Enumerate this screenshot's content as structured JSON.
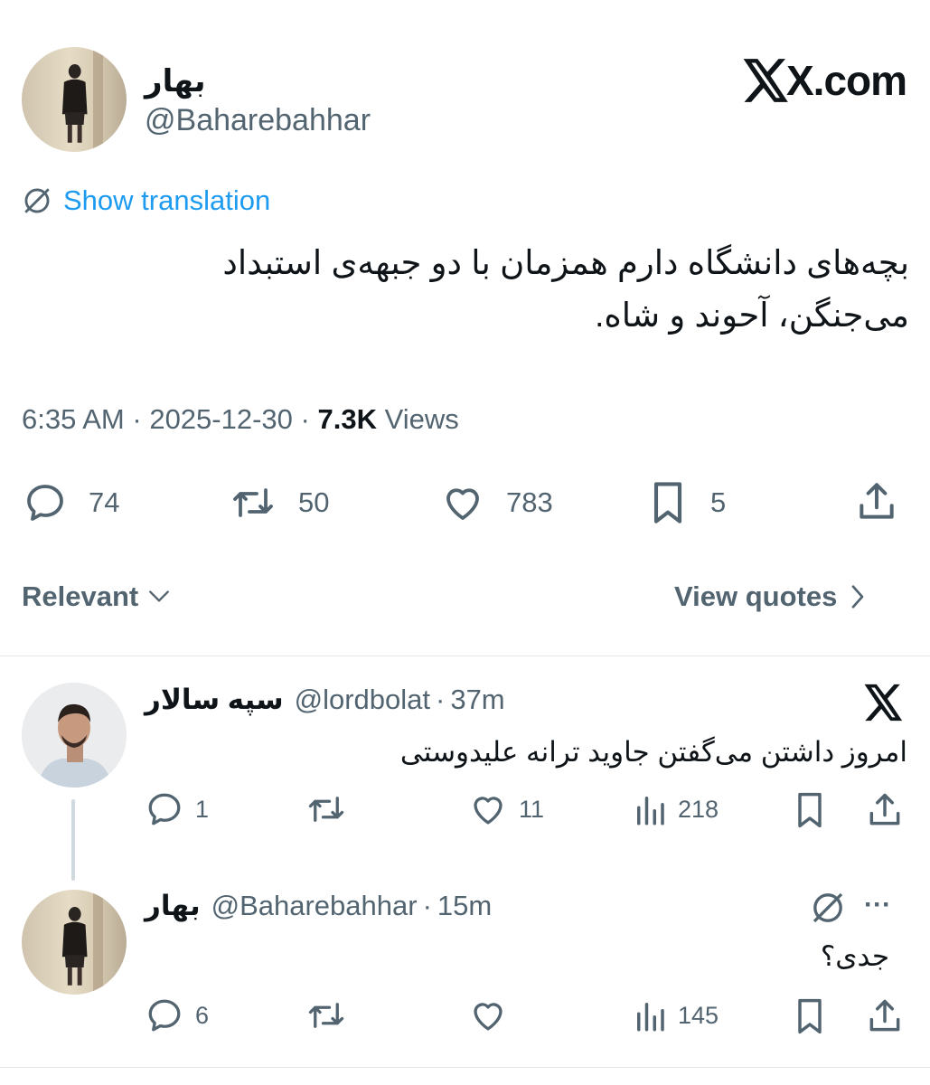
{
  "main_tweet": {
    "author_name": "بهار",
    "handle": "@Baharebahhar",
    "site_label": "X.com",
    "show_translation": "Show translation",
    "text_line1": "بچه‌های دانشگاه دارم همزمان با دو جبهه‌ی استبداد",
    "text_line2": "می‌جنگن، آحوند و شاه.",
    "time": "6:35 AM",
    "date": "2025-12-30",
    "views_count": "7.3K",
    "views_label": "Views",
    "sep": "·",
    "replies": "74",
    "reposts": "50",
    "likes": "783",
    "bookmarks": "5",
    "icons": [
      "reply-icon",
      "repost-icon",
      "like-icon",
      "bookmark-icon",
      "share-icon",
      "translate-icon"
    ]
  },
  "filters": {
    "sort_label": "Relevant",
    "quotes_label": "View quotes"
  },
  "replies": [
    {
      "author_name": "سپه سالار",
      "handle": "@lordbolat",
      "time": "37m",
      "text": "امروز داشتن می‌گفتن جاوید ترانه علیدوستی",
      "replies": "1",
      "reposts": "",
      "likes": "11",
      "views": "218"
    },
    {
      "author_name": "بهار",
      "handle": "@Baharebahhar",
      "time": "15m",
      "text": "جدی؟",
      "replies": "6",
      "reposts": "",
      "likes": "",
      "views": "145",
      "more": "···"
    }
  ],
  "colors": {
    "accent": "#1d9bf0",
    "text": "#0f1419",
    "secondary": "#536471",
    "divider": "#e3e6e8"
  }
}
